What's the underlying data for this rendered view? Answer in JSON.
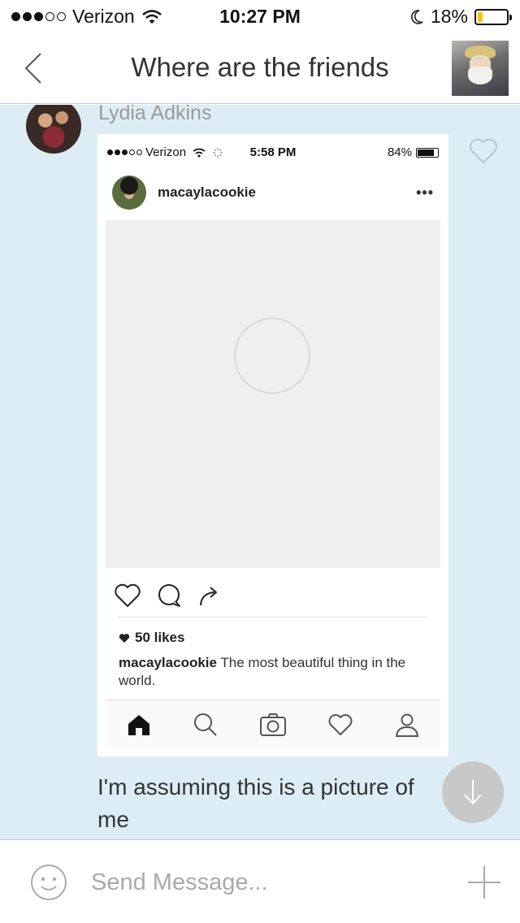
{
  "status_bar": {
    "carrier": "Verizon",
    "time": "10:27 PM",
    "battery": "18%",
    "battery_level": 0.18,
    "battery_color": "#f5c400"
  },
  "nav": {
    "title": "Where are the friends",
    "back_icon": "chevron-left-icon",
    "avatar": "group-avatar"
  },
  "message": {
    "sender": "Lydia Adkins",
    "text": "I'm assuming this is a picture of me",
    "like_icon": "heart-outline-icon"
  },
  "shared_screenshot": {
    "status": {
      "carrier": "Verizon",
      "time": "5:58 PM",
      "battery": "84%"
    },
    "username": "macaylacookie",
    "more": "•••",
    "likes": "50 likes",
    "caption_user": "macaylacookie",
    "caption_text": " The most beautiful thing in the world.",
    "tab_icons": [
      "home-icon",
      "search-icon",
      "camera-icon",
      "heart-icon",
      "profile-icon"
    ]
  },
  "composer": {
    "placeholder": "Send Message..."
  },
  "colors": {
    "chat_background": "#dcedf5",
    "image_placeholder": "#efefef"
  }
}
